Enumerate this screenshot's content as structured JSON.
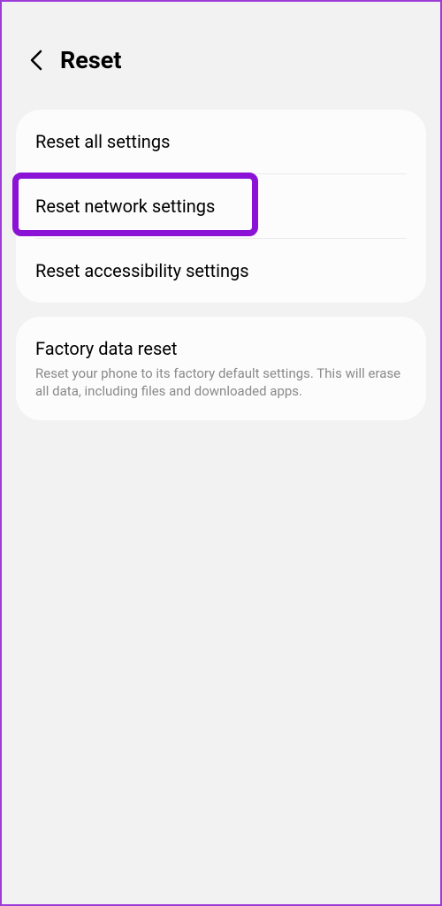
{
  "header": {
    "title": "Reset"
  },
  "group1": {
    "items": [
      {
        "title": "Reset all settings"
      },
      {
        "title": "Reset network settings"
      },
      {
        "title": "Reset accessibility settings"
      }
    ]
  },
  "group2": {
    "item": {
      "title": "Factory data reset",
      "description": "Reset your phone to its factory default settings. This will erase all data, including files and downloaded apps."
    }
  },
  "highlight": {
    "color": "#8a13d6"
  }
}
